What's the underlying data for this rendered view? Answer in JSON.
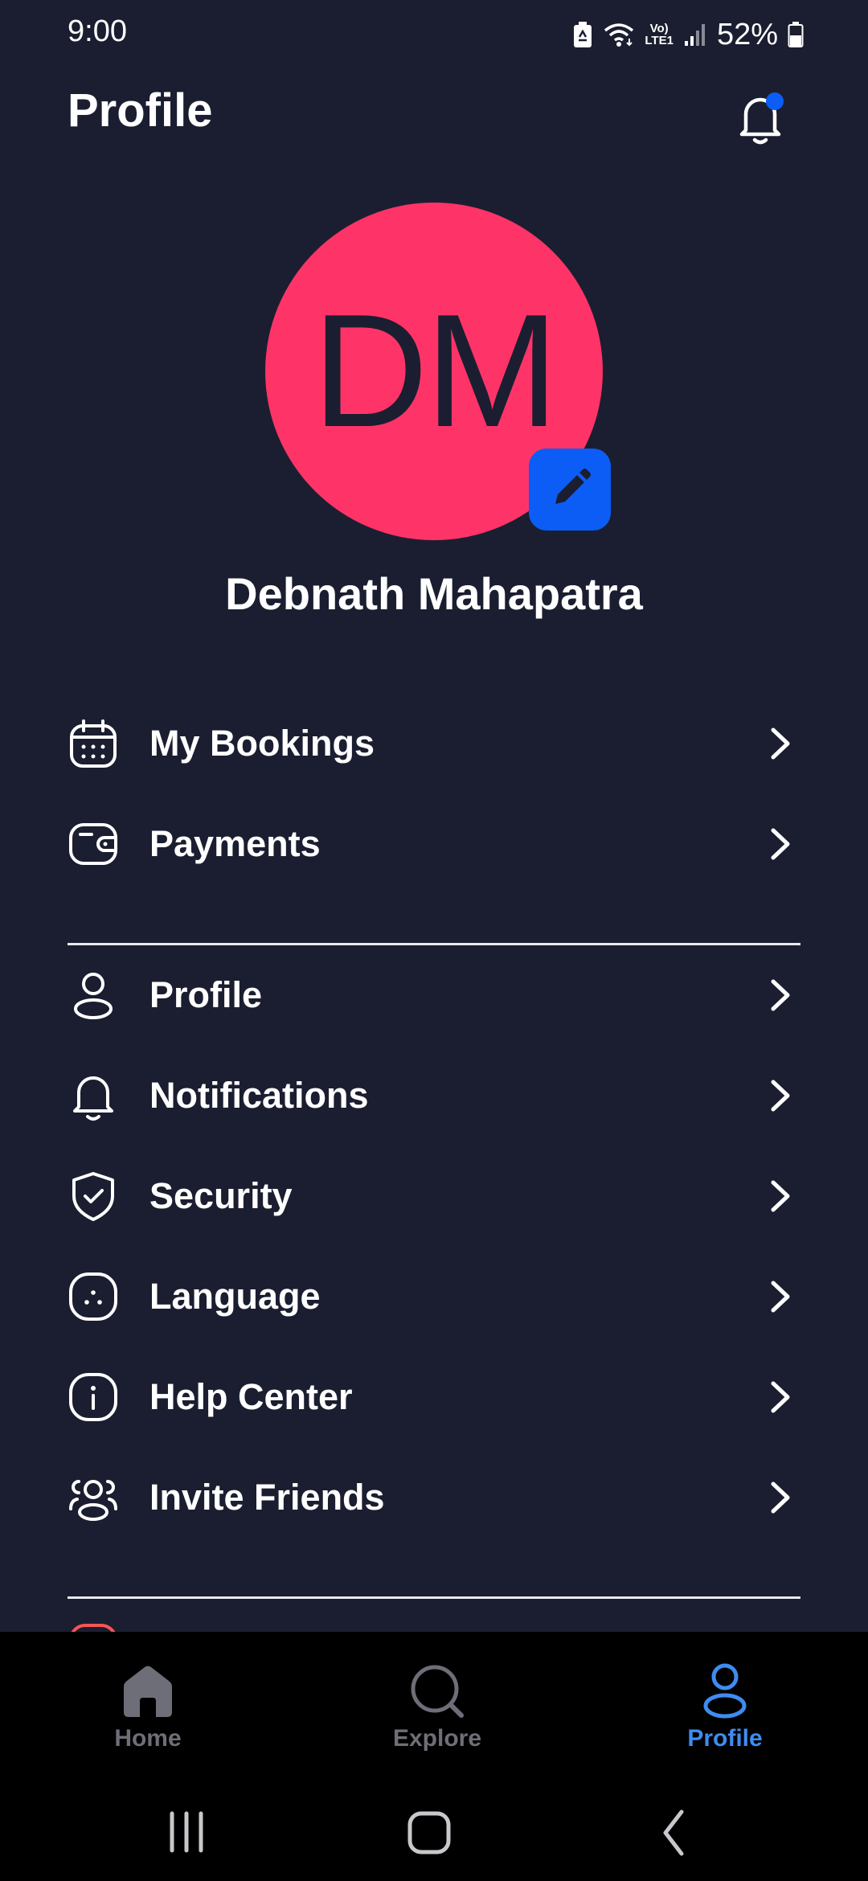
{
  "status_bar": {
    "time": "9:00",
    "lte_top": "Vo)",
    "lte_bottom": "LTE1",
    "battery": "52%"
  },
  "header": {
    "title": "Profile",
    "has_notification_dot": true
  },
  "profile": {
    "initials": "DM",
    "name": "Debnath Mahapatra",
    "avatar_color": "#FE3468"
  },
  "menu_group_1": [
    {
      "label": "My Bookings",
      "icon": "calendar-icon"
    },
    {
      "label": "Payments",
      "icon": "wallet-icon"
    }
  ],
  "menu_group_2": [
    {
      "label": "Profile",
      "icon": "user-icon"
    },
    {
      "label": "Notifications",
      "icon": "bell-icon"
    },
    {
      "label": "Security",
      "icon": "shield-icon"
    },
    {
      "label": "Language",
      "icon": "language-icon"
    },
    {
      "label": "Help Center",
      "icon": "info-icon"
    },
    {
      "label": "Invite Friends",
      "icon": "users-icon"
    }
  ],
  "bottom_nav": {
    "items": [
      {
        "label": "Home",
        "icon": "home-icon",
        "active": false
      },
      {
        "label": "Explore",
        "icon": "search-icon",
        "active": false
      },
      {
        "label": "Profile",
        "icon": "user-icon",
        "active": true
      }
    ]
  },
  "colors": {
    "background": "#1B1E30",
    "accent": "#0B5DF5",
    "nav_active": "#3E8CF0",
    "nav_inactive": "#6E6E78",
    "logout_red": "#F75555"
  }
}
